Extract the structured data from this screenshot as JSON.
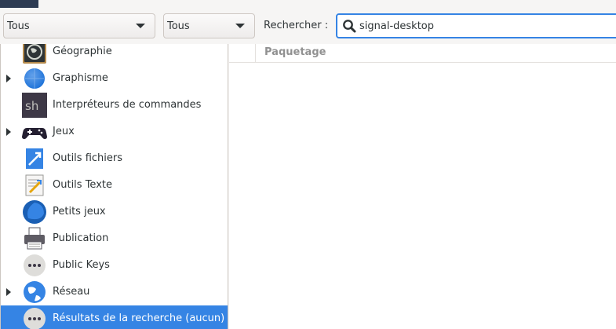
{
  "toolbar": {
    "filter1": "Tous",
    "filter2": "Tous",
    "search_label": "Rechercher :",
    "search_value": "signal-desktop"
  },
  "sidebar": {
    "items": [
      {
        "label": "Géographie",
        "icon": "globe-dark-icon",
        "expandable": false,
        "selected": false
      },
      {
        "label": "Graphisme",
        "icon": "graphics-sphere-icon",
        "expandable": true,
        "selected": false
      },
      {
        "label": "Interpréteurs de commandes",
        "icon": "sh-terminal-icon",
        "expandable": false,
        "selected": false
      },
      {
        "label": "Jeux",
        "icon": "gamepad-icon",
        "expandable": true,
        "selected": false
      },
      {
        "label": "Outils fichiers",
        "icon": "file-tools-icon",
        "expandable": false,
        "selected": false
      },
      {
        "label": "Outils Texte",
        "icon": "text-tools-icon",
        "expandable": false,
        "selected": false
      },
      {
        "label": "Petits jeux",
        "icon": "small-games-icon",
        "expandable": false,
        "selected": false
      },
      {
        "label": "Publication",
        "icon": "printer-icon",
        "expandable": false,
        "selected": false
      },
      {
        "label": "Public Keys",
        "icon": "more-dots-icon",
        "expandable": false,
        "selected": false
      },
      {
        "label": "Réseau",
        "icon": "network-globe-icon",
        "expandable": true,
        "selected": false
      },
      {
        "label": "Résultats de la recherche (aucun)",
        "icon": "more-dots-icon",
        "expandable": false,
        "selected": true
      }
    ]
  },
  "package_list": {
    "column_package": "Paquetage"
  },
  "colors": {
    "accent": "#3584e4",
    "selection_text": "#ffffff"
  }
}
